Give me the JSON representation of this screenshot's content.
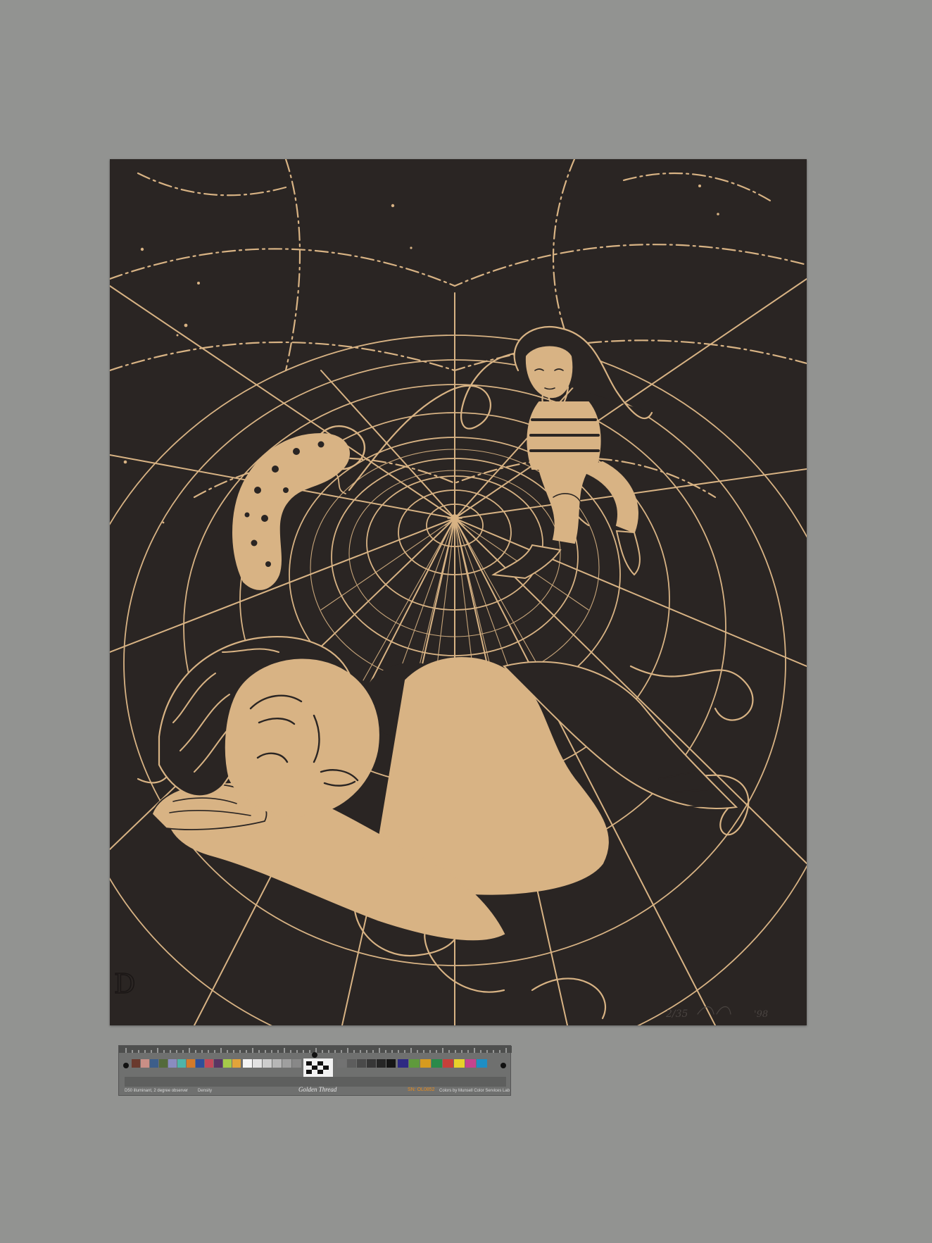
{
  "artwork": {
    "print_edition": "2/35",
    "print_year": "'98",
    "chop_mark": "D",
    "paper_color": "#2a2523",
    "ink_color": "#d8b384"
  },
  "color_target": {
    "left_text": "D50 illuminant, 2 degree observer",
    "density_label": "Density",
    "brand": "Golden Thread",
    "serial": "SN: OL0852",
    "right_text": "Colors by Munsell Color Services Lab",
    "patches": [
      "#6a3a2e",
      "#c98f86",
      "#3d5e8a",
      "#546a3b",
      "#8a8cc0",
      "#4fb3a8",
      "#d37a2a",
      "#2f4f9a",
      "#c2495a",
      "#5a3563",
      "#a6c94a",
      "#e2a43a"
    ],
    "gray_patches": [
      "#f5f5f5",
      "#e3e3e3",
      "#cdcdcd",
      "#b6b6b6",
      "#9f9f9f",
      "#888888",
      "#727272",
      "#5d5d5d",
      "#4a4a4a",
      "#373737",
      "#262626",
      "#151515"
    ],
    "right_patches": [
      "#2e2a82",
      "#5f9a3c",
      "#d79b1f",
      "#2a8a4a",
      "#c7403a",
      "#e8d02a",
      "#c4438e",
      "#1e8ec4"
    ]
  }
}
